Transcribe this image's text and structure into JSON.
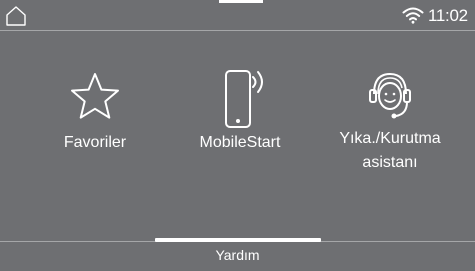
{
  "status_bar": {
    "home_icon": "home-icon",
    "wifi_icon": "wifi-icon",
    "time": "11:02"
  },
  "tiles": [
    {
      "label": "Favoriler",
      "icon": "star-icon"
    },
    {
      "label": "MobileStart",
      "icon": "smartphone-signal-icon"
    },
    {
      "label_line1": "Yıka./Kurutma",
      "label_line2": "asistanı",
      "icon": "headset-assistant-icon"
    }
  ],
  "footer": {
    "help_label": "Yardım"
  },
  "colors": {
    "background": "#6e6f72",
    "foreground": "#ffffff",
    "divider": "#a5a6a8"
  }
}
